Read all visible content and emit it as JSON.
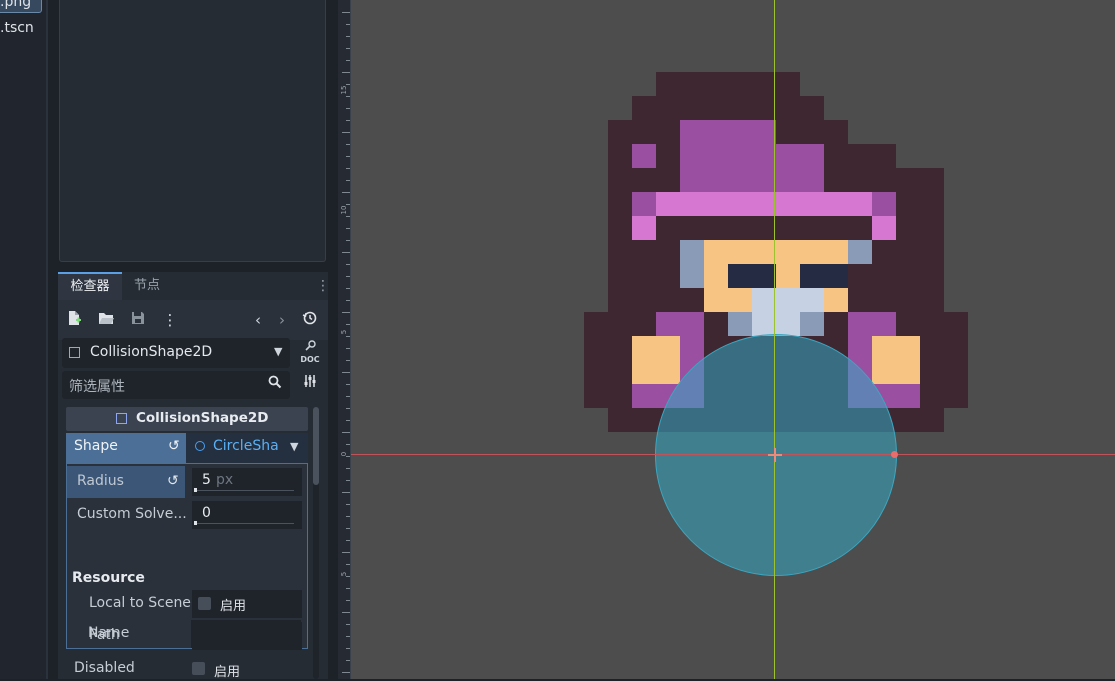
{
  "filesystem": {
    "selected_file": ".png",
    "other_file": ".tscn"
  },
  "inspector": {
    "tabs": [
      {
        "label": "检查器"
      },
      {
        "label": "节点"
      }
    ],
    "node_type": "CollisionShape2D",
    "filter_placeholder": "筛选属性",
    "class_header": "CollisionShape2D",
    "shape": {
      "label": "Shape",
      "value": "CircleSha"
    },
    "radius": {
      "label": "Radius",
      "value": "5",
      "unit": "px"
    },
    "custom_solver": {
      "label": "Custom Solve...",
      "value": "0"
    },
    "resource": {
      "title": "Resource",
      "local_to_scene": {
        "label": "Local to Scene",
        "checkbox_label": "启用"
      },
      "path": {
        "label": "Path",
        "value": ""
      },
      "name": {
        "label": "Name",
        "value": ""
      }
    },
    "disabled": {
      "label": "Disabled",
      "checkbox_label": "启用"
    }
  },
  "viewport": {
    "ruler_labels": [
      "15",
      "10",
      "5",
      "0",
      "5"
    ],
    "colors": {
      "background": "#4d4d4d",
      "y_axis": "#9cc22d",
      "x_axis": "#c0525a",
      "collision_shape": "#34aac4"
    }
  }
}
